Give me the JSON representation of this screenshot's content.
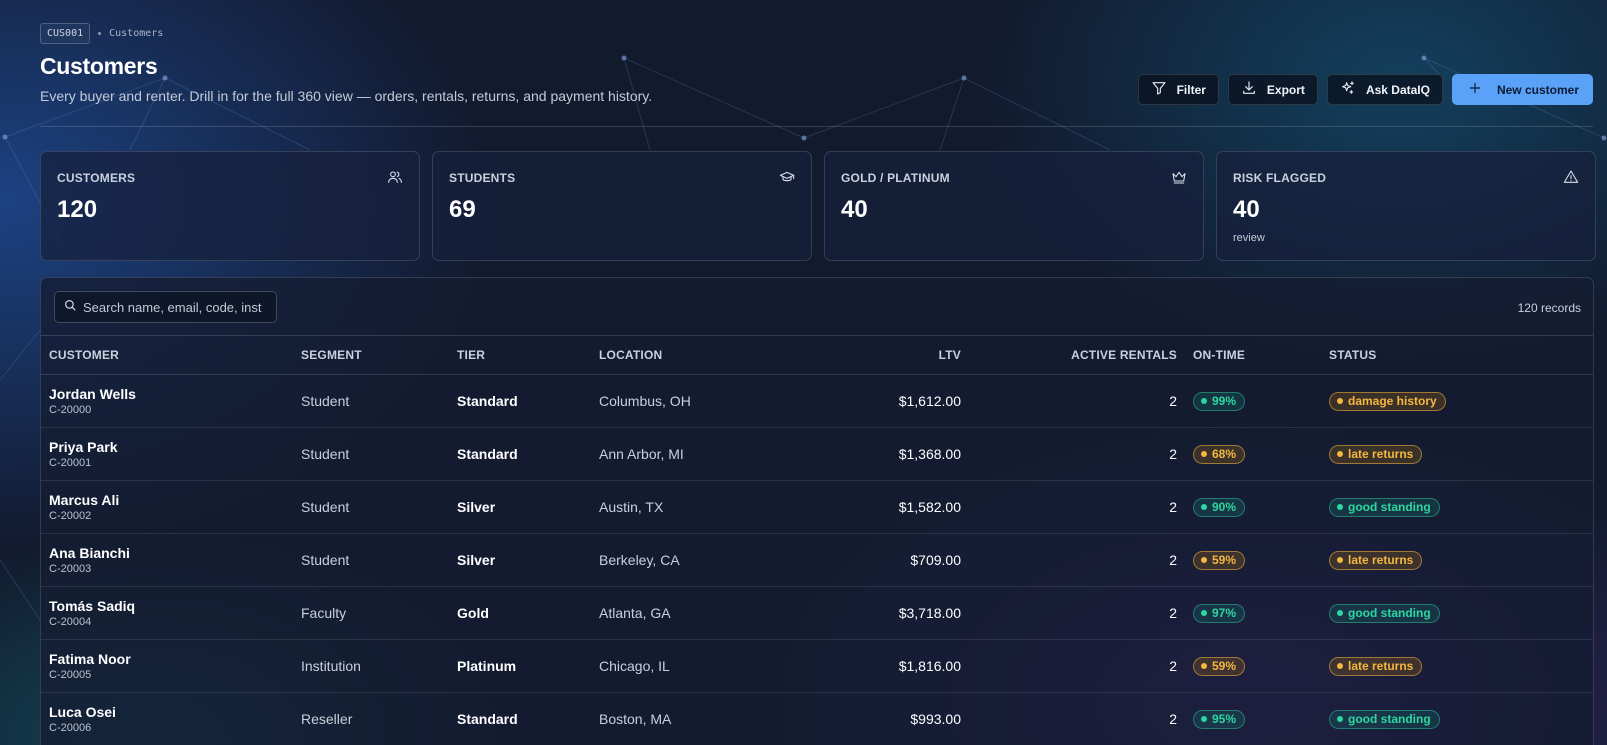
{
  "breadcrumb": {
    "code": "CUS001",
    "current": "Customers"
  },
  "header": {
    "title": "Customers",
    "subtitle": "Every buyer and renter. Drill in for the full 360 view — orders, rentals, returns, and payment history."
  },
  "actions": {
    "filter": "Filter",
    "export": "Export",
    "ask": "Ask DataIQ",
    "new": "New customer"
  },
  "stats": [
    {
      "label": "CUSTOMERS",
      "value": "120",
      "icon": "users-icon"
    },
    {
      "label": "STUDENTS",
      "value": "69",
      "icon": "graduation-cap-icon"
    },
    {
      "label": "GOLD / PLATINUM",
      "value": "40",
      "icon": "crown-icon"
    },
    {
      "label": "RISK FLAGGED",
      "value": "40",
      "sub": "review",
      "icon": "warning-icon"
    }
  ],
  "table": {
    "search_placeholder": "Search name, email, code, inst",
    "record_count": "120 records",
    "columns": [
      "CUSTOMER",
      "SEGMENT",
      "TIER",
      "LOCATION",
      "LTV",
      "ACTIVE RENTALS",
      "ON-TIME",
      "STATUS"
    ],
    "rows": [
      {
        "name": "Jordan Wells",
        "code": "C-20000",
        "segment": "Student",
        "tier": "Standard",
        "location": "Columbus, OH",
        "ltv": "$1,612.00",
        "rentals": "2",
        "ontime": "99%",
        "ontime_tone": "green",
        "status": "damage history",
        "status_tone": "amber"
      },
      {
        "name": "Priya Park",
        "code": "C-20001",
        "segment": "Student",
        "tier": "Standard",
        "location": "Ann Arbor, MI",
        "ltv": "$1,368.00",
        "rentals": "2",
        "ontime": "68%",
        "ontime_tone": "amber",
        "status": "late returns",
        "status_tone": "amber"
      },
      {
        "name": "Marcus Ali",
        "code": "C-20002",
        "segment": "Student",
        "tier": "Silver",
        "location": "Austin, TX",
        "ltv": "$1,582.00",
        "rentals": "2",
        "ontime": "90%",
        "ontime_tone": "green",
        "status": "good standing",
        "status_tone": "green"
      },
      {
        "name": "Ana Bianchi",
        "code": "C-20003",
        "segment": "Student",
        "tier": "Silver",
        "location": "Berkeley, CA",
        "ltv": "$709.00",
        "rentals": "2",
        "ontime": "59%",
        "ontime_tone": "amber",
        "status": "late returns",
        "status_tone": "amber"
      },
      {
        "name": "Tomás Sadiq",
        "code": "C-20004",
        "segment": "Faculty",
        "tier": "Gold",
        "location": "Atlanta, GA",
        "ltv": "$3,718.00",
        "rentals": "2",
        "ontime": "97%",
        "ontime_tone": "green",
        "status": "good standing",
        "status_tone": "green"
      },
      {
        "name": "Fatima Noor",
        "code": "C-20005",
        "segment": "Institution",
        "tier": "Platinum",
        "location": "Chicago, IL",
        "ltv": "$1,816.00",
        "rentals": "2",
        "ontime": "59%",
        "ontime_tone": "amber",
        "status": "late returns",
        "status_tone": "amber"
      },
      {
        "name": "Luca Osei",
        "code": "C-20006",
        "segment": "Reseller",
        "tier": "Standard",
        "location": "Boston, MA",
        "ltv": "$993.00",
        "rentals": "2",
        "ontime": "95%",
        "ontime_tone": "green",
        "status": "good standing",
        "status_tone": "green"
      }
    ]
  },
  "colors": {
    "accent": "#5aa2f8",
    "good": "#2ed6a0",
    "warn": "#f4b740",
    "background": "#121a2e"
  }
}
